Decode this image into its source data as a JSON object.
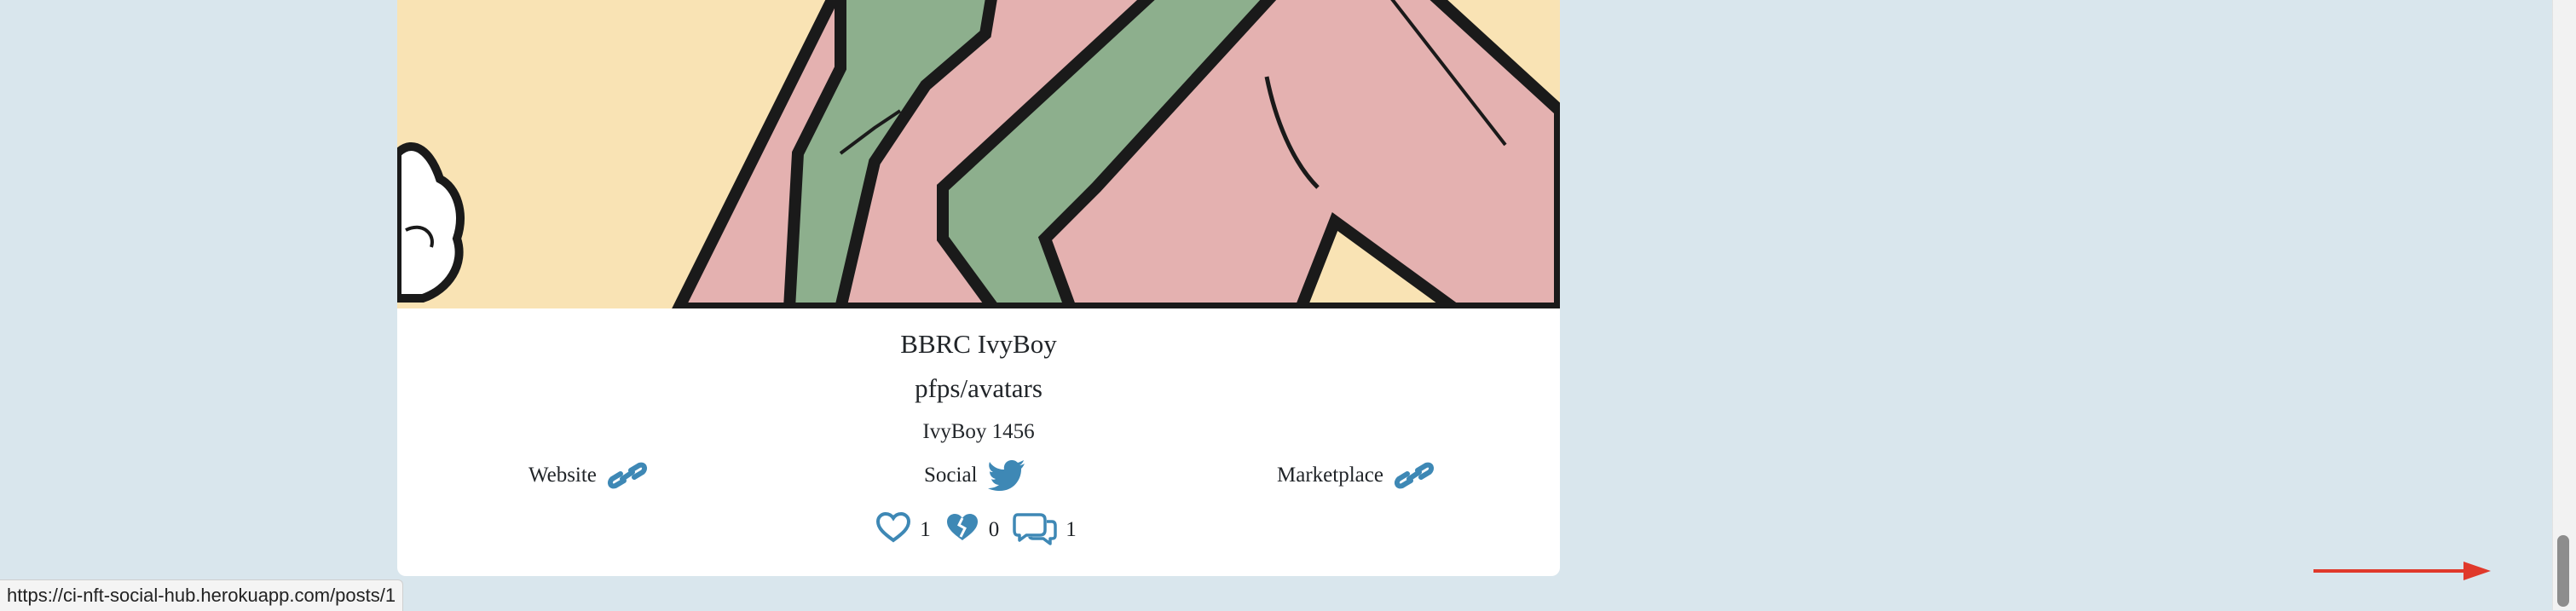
{
  "post": {
    "title": "BBRC IvyBoy",
    "category": "pfps/avatars",
    "nft_name": "IvyBoy 1456",
    "links": {
      "website_label": "Website",
      "social_label": "Social",
      "marketplace_label": "Marketplace"
    },
    "stats": {
      "likes": "1",
      "dislikes": "0",
      "comments": "1"
    }
  },
  "status_bar": {
    "url": "https://ci-nft-social-hub.herokuapp.com/posts/1"
  },
  "colors": {
    "page_bg": "#d9e6ed",
    "icon_blue": "#3e88b5",
    "annotation_red": "#e0392b"
  },
  "icons": [
    "link-icon",
    "twitter-icon",
    "heart-icon",
    "broken-heart-icon",
    "comments-icon"
  ]
}
